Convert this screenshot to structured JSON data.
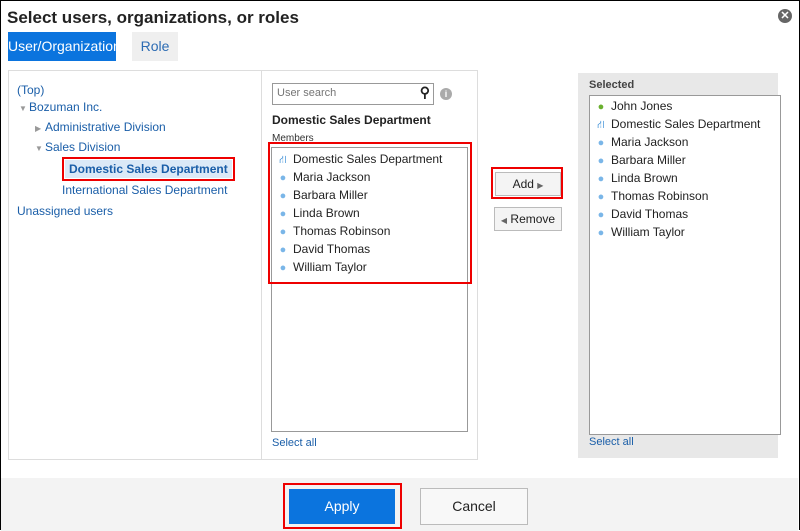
{
  "dialog": {
    "title": "Select users, organizations, or roles",
    "close_icon": "close-circle-icon"
  },
  "tabs": [
    {
      "label": "User/Organization",
      "active": true
    },
    {
      "label": "Role",
      "active": false
    }
  ],
  "tree": {
    "items": [
      {
        "label": "(Top)",
        "level": 0,
        "toggle": "none"
      },
      {
        "label": "Bozuman Inc.",
        "level": 0,
        "toggle": "expanded"
      },
      {
        "label": "Administrative Division",
        "level": 1,
        "toggle": "collapsed"
      },
      {
        "label": "Sales Division",
        "level": 1,
        "toggle": "expanded"
      },
      {
        "label": "Domestic Sales Department",
        "level": 2,
        "toggle": "none",
        "selected": true
      },
      {
        "label": "International Sales Department",
        "level": 2,
        "toggle": "none"
      },
      {
        "label": "Unassigned users",
        "level": 0,
        "toggle": "none"
      }
    ]
  },
  "search": {
    "placeholder": "User search",
    "value": ""
  },
  "members": {
    "department_title": "Domestic Sales Department",
    "label": "Members",
    "items": [
      {
        "label": "Domestic Sales Department",
        "type": "organization"
      },
      {
        "label": "Maria Jackson",
        "type": "user"
      },
      {
        "label": "Barbara Miller",
        "type": "user"
      },
      {
        "label": "Linda Brown",
        "type": "user"
      },
      {
        "label": "Thomas Robinson",
        "type": "user"
      },
      {
        "label": "David Thomas",
        "type": "user"
      },
      {
        "label": "William Taylor",
        "type": "user"
      }
    ],
    "select_all": "Select all"
  },
  "actions": {
    "add": "Add",
    "remove": "Remove",
    "add_arrow": "▶",
    "remove_arrow": "◀"
  },
  "selected": {
    "label": "Selected",
    "items": [
      {
        "label": "John Jones",
        "type": "user-self"
      },
      {
        "label": "Domestic Sales Department",
        "type": "organization"
      },
      {
        "label": "Maria Jackson",
        "type": "user"
      },
      {
        "label": "Barbara Miller",
        "type": "user"
      },
      {
        "label": "Linda Brown",
        "type": "user"
      },
      {
        "label": "Thomas Robinson",
        "type": "user"
      },
      {
        "label": "David Thomas",
        "type": "user"
      },
      {
        "label": "William Taylor",
        "type": "user"
      }
    ],
    "select_all": "Select all"
  },
  "footer": {
    "apply": "Apply",
    "cancel": "Cancel"
  },
  "colors": {
    "primary": "#0b74de",
    "link": "#1a5ea8",
    "highlight": "#e00000"
  }
}
